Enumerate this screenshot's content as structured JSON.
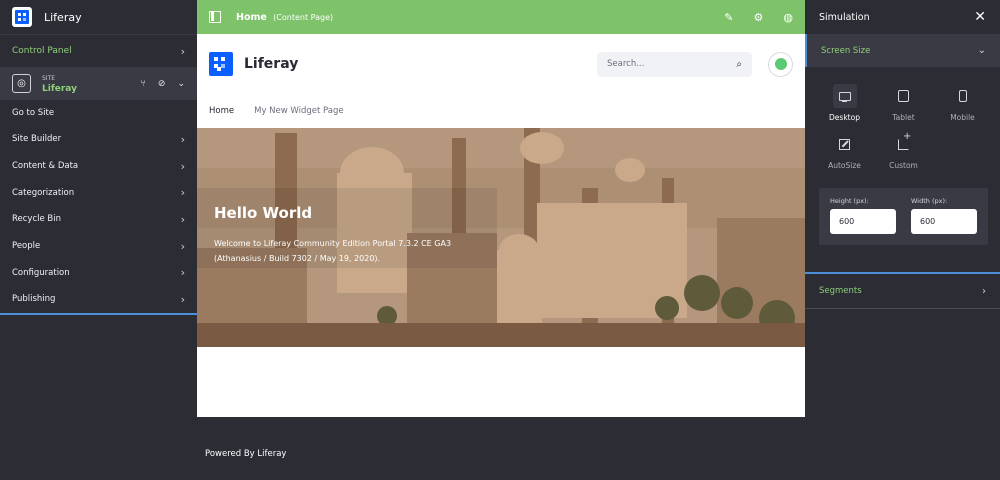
{
  "left_panel": {
    "app_title": "Liferay",
    "control_panel": "Control Panel",
    "site_caption": "SITE",
    "site_name": "Liferay",
    "items": [
      "Go to Site",
      "Site Builder",
      "Content & Data",
      "Categorization",
      "Recycle Bin",
      "People",
      "Configuration",
      "Publishing"
    ]
  },
  "topbar": {
    "page_name": "Home",
    "page_type": "(Content Page)"
  },
  "preview": {
    "site_name": "Liferay",
    "search_placeholder": "Search...",
    "nav": [
      "Home",
      "My New Widget Page"
    ],
    "hero_title": "Hello World",
    "hero_text": "Welcome to Liferay Community Edition Portal 7.3.2 CE GA3 (Athanasius / Build 7302 / May 19, 2020).",
    "footer": "Powered By Liferay"
  },
  "simulation": {
    "title": "Simulation",
    "screen_size_label": "Screen Size",
    "sizes": [
      "Desktop",
      "Tablet",
      "Mobile",
      "AutoSize",
      "Custom"
    ],
    "selected_size": "Desktop",
    "height_label": "Height (px):",
    "height_value": "600",
    "width_label": "Width (px):",
    "width_value": "600",
    "segments_label": "Segments"
  },
  "colors": {
    "accent_green": "#7ec36a",
    "brand_blue": "#0b5fff",
    "panel_bg": "#2b2c34",
    "highlight_blue": "#4d8fd6"
  },
  "icons": {
    "topbar_actions": [
      "pencil-icon",
      "gear-icon",
      "globe-icon"
    ],
    "site_actions": [
      "tree-icon",
      "compass-icon",
      "chevron-down-icon"
    ]
  }
}
